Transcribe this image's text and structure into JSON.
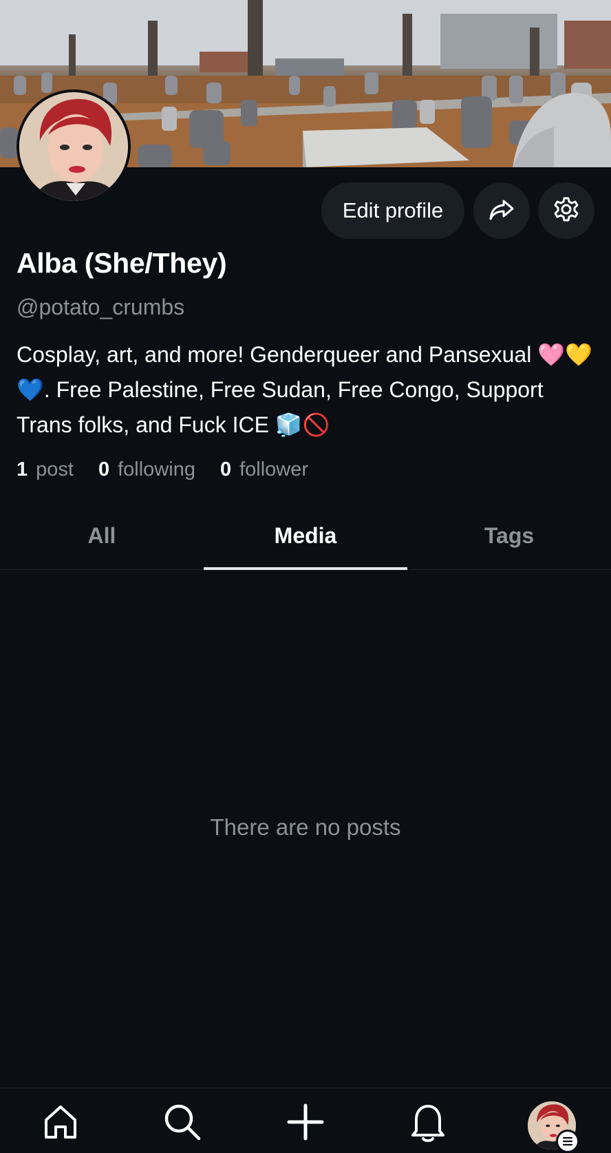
{
  "profile": {
    "display_name": "Alba (She/They)",
    "handle": "@potato_crumbs",
    "bio": "Cosplay, art, and more! Genderqueer and Pansexual 🩷💛💙. Free Palestine, Free Sudan, Free Congo, Support Trans folks, and Fuck ICE 🧊🚫"
  },
  "actions": {
    "edit_label": "Edit profile",
    "share_icon": "share-icon",
    "settings_icon": "gear-icon"
  },
  "stats": {
    "posts_count": "1",
    "posts_label": "post",
    "following_count": "0",
    "following_label": "following",
    "followers_count": "0",
    "followers_label": "follower"
  },
  "tabs": [
    {
      "label": "All",
      "active": false
    },
    {
      "label": "Media",
      "active": true
    },
    {
      "label": "Tags",
      "active": false
    }
  ],
  "empty_state": "There are no posts",
  "bottom_nav": {
    "items": [
      "home-icon",
      "search-icon",
      "plus-icon",
      "bell-icon",
      "profile-avatar"
    ]
  },
  "colors": {
    "background": "#0b0e13",
    "button_bg": "#1a1e25",
    "muted_text": "#8c9299",
    "active_text": "#ffffff"
  }
}
